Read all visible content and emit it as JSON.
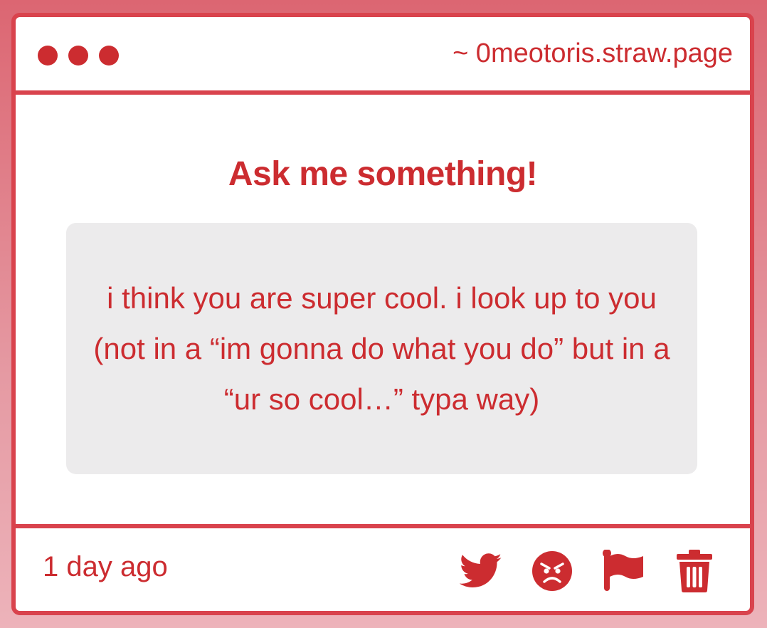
{
  "window": {
    "url": "~ 0meotoris.straw.page"
  },
  "page": {
    "heading": "Ask me something!"
  },
  "message": {
    "text": "i think you are super cool. i look up to you (not in a “im gonna do what you do” but in a “ur so cool…” typa way)",
    "timestamp": "1 day ago"
  },
  "actions": [
    {
      "icon": "twitter-icon"
    },
    {
      "icon": "angry-face-icon"
    },
    {
      "icon": "flag-icon"
    },
    {
      "icon": "trash-icon"
    }
  ],
  "colors": {
    "accent": "#cc2c30",
    "border": "#d9434d",
    "card_background": "#ecebec",
    "window_background": "#ffffff"
  }
}
